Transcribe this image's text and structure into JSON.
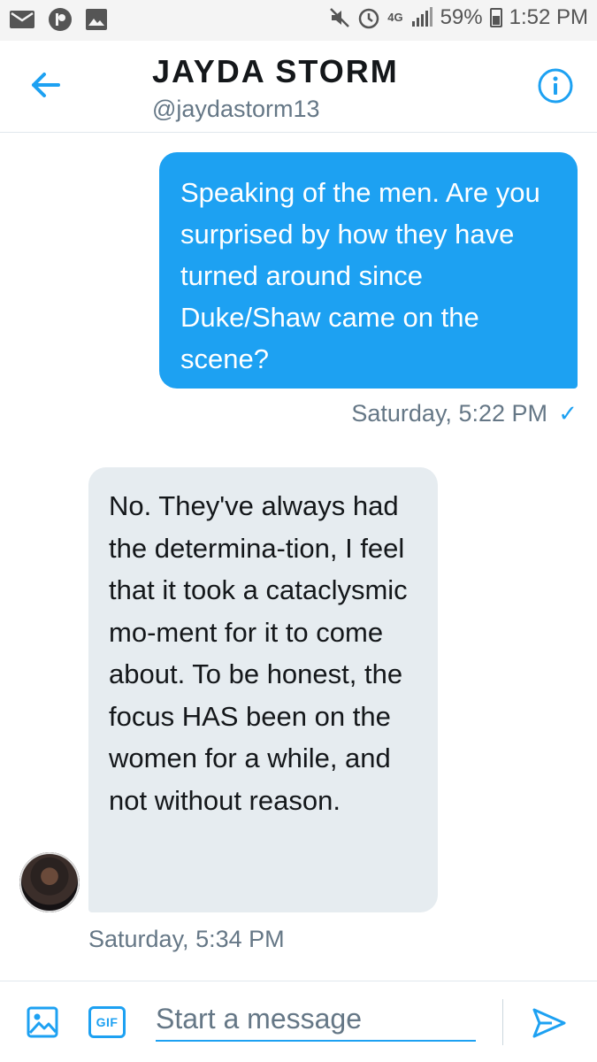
{
  "status_bar": {
    "battery": "59%",
    "time": "1:52 PM",
    "network": "4G",
    "icons": [
      "mail-icon",
      "p-app-icon",
      "image-icon",
      "mute-icon",
      "alarm-icon",
      "network-icon",
      "signal-icon",
      "battery-icon"
    ]
  },
  "header": {
    "name": "JAYDA STORM",
    "handle": "@jaydastorm13",
    "icons": [
      "back-arrow-icon",
      "info-icon"
    ]
  },
  "conversation": {
    "sent": {
      "text": "Speaking of the men. Are you surprised by how they have turned around since Duke/Shaw came on the scene?",
      "timestamp": "Saturday, 5:22 PM",
      "read_mark": "✓"
    },
    "received": {
      "text": "No. They've always had the determina-tion, I feel that it took a cataclysmic mo-ment for it to come about. To be honest, the focus HAS been on the women for a while, and not without reason.",
      "timestamp": "Saturday, 5:34 PM"
    }
  },
  "composer": {
    "placeholder": "Start a message",
    "gif_label": "GIF",
    "icons": [
      "image-icon",
      "gif-icon",
      "send-icon"
    ]
  },
  "colors": {
    "accent": "#1da1f2",
    "incoming_bubble": "#e6ecf0",
    "secondary_text": "#657786"
  }
}
